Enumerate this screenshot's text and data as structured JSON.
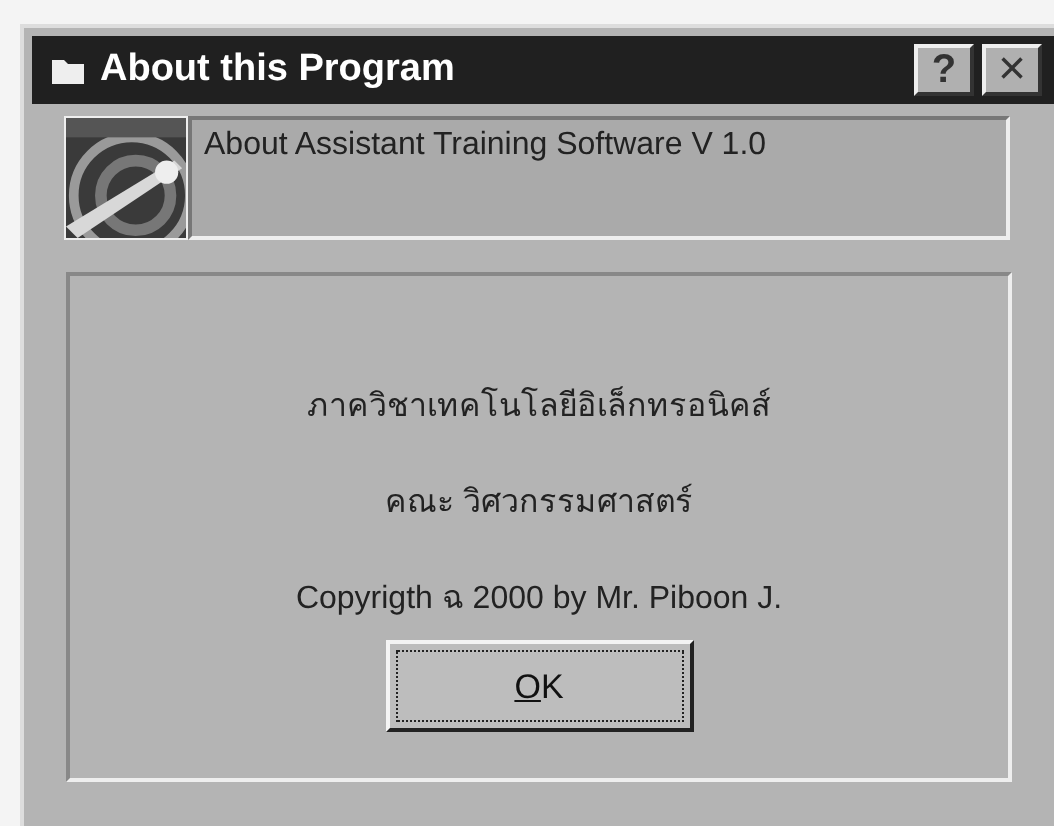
{
  "window": {
    "title": "About this Program"
  },
  "title_buttons": [
    {
      "kind": "help",
      "label": "?"
    },
    {
      "kind": "close",
      "label": "×"
    }
  ],
  "header": {
    "text": "About Assistant Training Software V 1.0"
  },
  "info_lines": [
    "ภาควิชาเทคโนโลยีอิเล็กทรอนิคส์",
    "คณะ วิศวกรรมศาสตร์",
    "Copyrigth ฉ 2000 by Mr. Piboon J."
  ],
  "buttons": [
    {
      "label": "OK",
      "focused": true
    }
  ]
}
